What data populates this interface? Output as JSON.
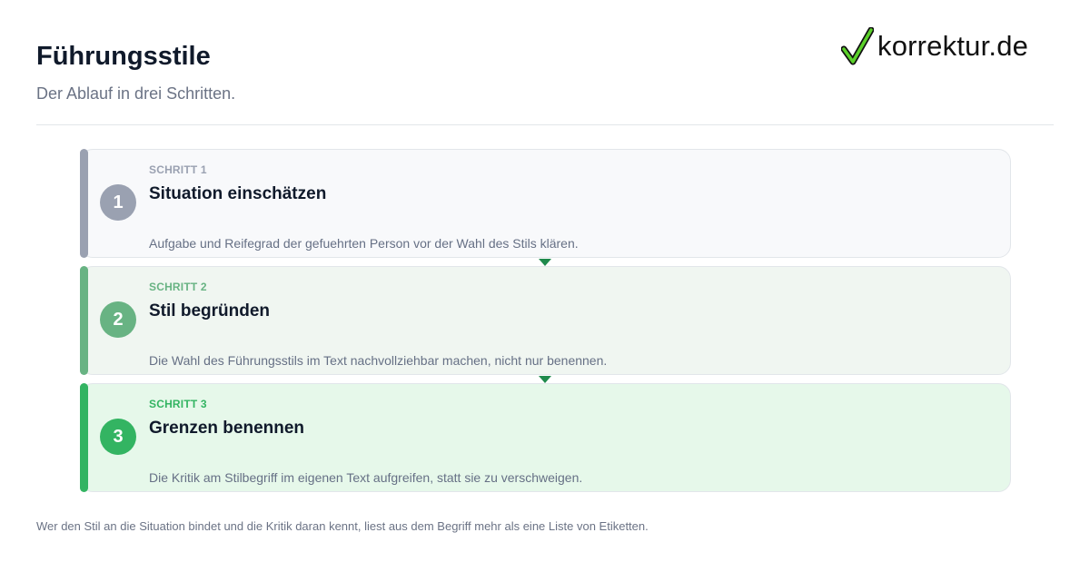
{
  "header": {
    "title": "Führungsstile",
    "subtitle": "Der Ablauf in drei Schritten."
  },
  "logo": {
    "text": "korrektur.de",
    "icon": "checkmark-icon",
    "check_color": "#5bd12a"
  },
  "steps": [
    {
      "label": "SCHRITT 1",
      "number": "1",
      "title": "Situation einschätzen",
      "description": "Aufgabe und Reifegrad der gefuehrten Person vor der Wahl des Stils klären.",
      "accent": "#9aa1b1",
      "background": "#f8f9fb"
    },
    {
      "label": "SCHRITT 2",
      "number": "2",
      "title": "Stil begründen",
      "description": "Die Wahl des Führungsstils im Text nachvollziehbar machen, nicht nur benennen.",
      "accent": "#68b383",
      "background": "#f0f6f1"
    },
    {
      "label": "SCHRITT 3",
      "number": "3",
      "title": "Grenzen benennen",
      "description": "Die Kritik am Stilbegriff im eigenen Text aufgreifen, statt sie zu verschweigen.",
      "accent": "#33b462",
      "background": "#e6f8ea"
    }
  ],
  "connector_color": "#1f8a4c",
  "footer": "Wer den Stil an die Situation bindet und die Kritik daran kennt, liest aus dem Begriff mehr als eine Liste von Etiketten."
}
